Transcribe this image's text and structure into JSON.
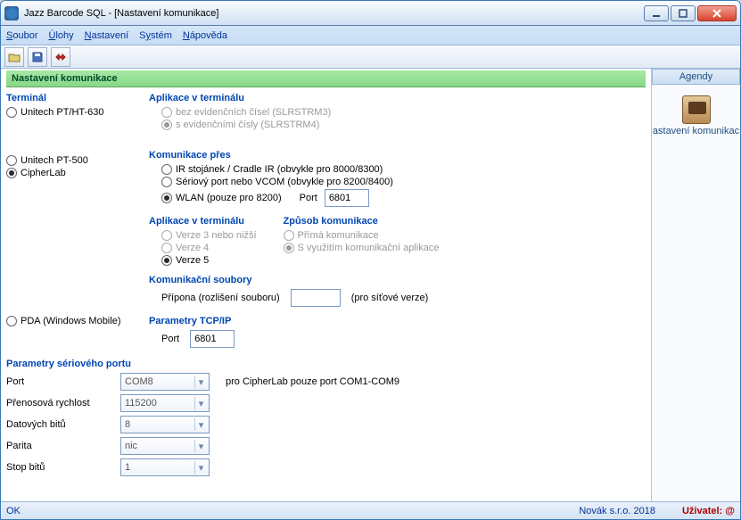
{
  "window": {
    "title": "Jazz Barcode SQL - [Nastavení komunikace]"
  },
  "menu": {
    "soubor": "Soubor",
    "ulohy": "Úlohy",
    "nastaveni": "Nastavení",
    "system": "Systém",
    "napoveda": "Nápověda"
  },
  "section": {
    "title": "Nastavení komunikace"
  },
  "side": {
    "head": "Agendy",
    "item1": "astavení komunikac"
  },
  "terminal": {
    "heading": "Terminál",
    "r1": "Unitech PT/HT-630",
    "r2": "Unitech PT-500",
    "r3": "CipherLab",
    "r4": "PDA (Windows Mobile)"
  },
  "apps1": {
    "heading": "Aplikace v terminálu",
    "o1": "bez evidenčních čísel (SLRSTRM3)",
    "o2": "s evidenčními čísly (SLRSTRM4)"
  },
  "komm": {
    "heading": "Komunikace přes",
    "o1": "IR stojánek / Cradle IR (obvykle pro 8000/8300)",
    "o2": "Sériový port nebo VCOM (obvykle pro 8200/8400)",
    "o3": "WLAN (pouze pro 8200)",
    "portlbl": "Port",
    "portval": "6801"
  },
  "apps2": {
    "heading": "Aplikace v terminálu",
    "o1": "Verze 3 nebo nižší",
    "o2": "Verze 4",
    "o3": "Verze 5"
  },
  "zpusob": {
    "heading": "Způsob komunikace",
    "o1": "Přímá komunikace",
    "o2": "S využitím komunikační aplikace"
  },
  "soubory": {
    "heading": "Komunikační soubory",
    "lbl": "Přípona (rozlišení souboru)",
    "note": "(pro síťové verze)"
  },
  "tcp": {
    "heading": "Parametry TCP/IP",
    "portlbl": "Port",
    "portval": "6801"
  },
  "serial": {
    "heading": "Parametry sériového portu",
    "port_l": "Port",
    "port_v": "COM8",
    "port_note": "pro CipherLab pouze port COM1-COM9",
    "baud_l": "Přenosová rychlost",
    "baud_v": "115200",
    "data_l": "Datových bitů",
    "data_v": "8",
    "parity_l": "Parita",
    "parity_v": "nic",
    "stop_l": "Stop bitů",
    "stop_v": "1"
  },
  "status": {
    "ok": "OK",
    "company": "Novák s.r.o. 2018",
    "user_l": "Uživatel:",
    "user_v": "@"
  }
}
